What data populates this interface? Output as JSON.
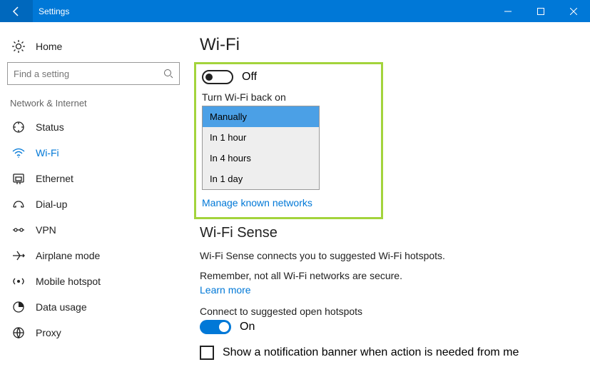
{
  "titlebar": {
    "title": "Settings"
  },
  "sidebar": {
    "home": "Home",
    "search_placeholder": "Find a setting",
    "category": "Network & Internet",
    "items": [
      {
        "label": "Status"
      },
      {
        "label": "Wi-Fi"
      },
      {
        "label": "Ethernet"
      },
      {
        "label": "Dial-up"
      },
      {
        "label": "VPN"
      },
      {
        "label": "Airplane mode"
      },
      {
        "label": "Mobile hotspot"
      },
      {
        "label": "Data usage"
      },
      {
        "label": "Proxy"
      }
    ]
  },
  "main": {
    "heading": "Wi-Fi",
    "wifi_toggle_state": "Off",
    "turnback_label": "Turn Wi-Fi back on",
    "turnback_options": [
      "Manually",
      "In 1 hour",
      "In 4 hours",
      "In 1 day"
    ],
    "manage_link": "Manage known networks",
    "sense_heading": "Wi-Fi Sense",
    "sense_desc": "Wi-Fi Sense connects you to suggested Wi-Fi hotspots.",
    "sense_warn": "Remember, not all Wi-Fi networks are secure.",
    "learn_more": "Learn more",
    "connect_label": "Connect to suggested open hotspots",
    "connect_toggle_state": "On",
    "notification_checkbox": "Show a notification banner when action is needed from me"
  }
}
